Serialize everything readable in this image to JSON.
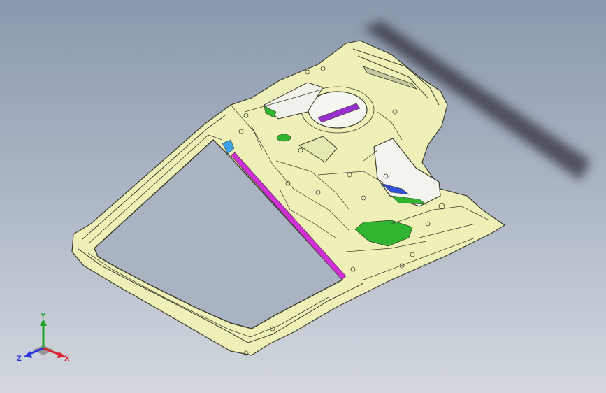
{
  "viewport": {
    "background_top": "#8b98ad",
    "background_bottom": "#d3d8de"
  },
  "model": {
    "panel_color": "#eef0b8",
    "edge_color": "#3b3d2a",
    "highlight_colors": {
      "green": "#2fb52f",
      "purple": "#9a2fd0",
      "blue": "#2f4fd6",
      "magenta": "#d12fd6",
      "cyan": "#3aa2e6"
    }
  },
  "triad": {
    "x_label": "X",
    "y_label": "Y",
    "z_label": "Z",
    "x_color": "#e0202a",
    "y_color": "#1fa52a",
    "z_color": "#2a36d8"
  }
}
